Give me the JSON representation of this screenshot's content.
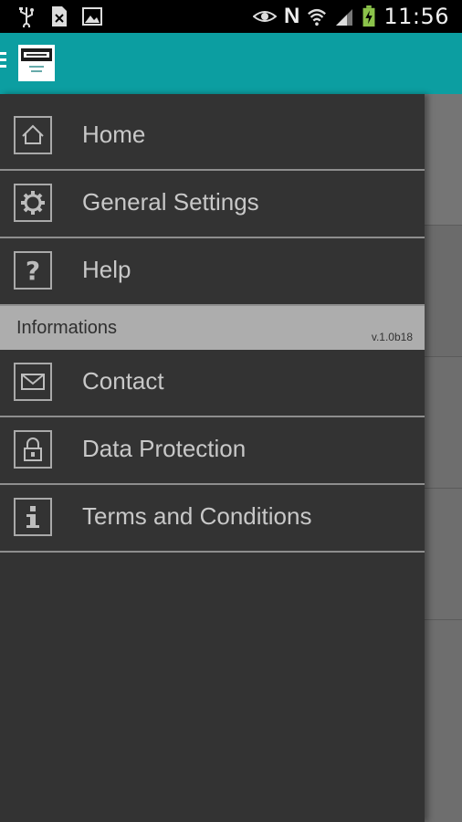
{
  "status_bar": {
    "time": "11:56",
    "network_letter": "N"
  },
  "app_bar": {
    "menu_icon": "hamburger-icon",
    "logo": "app-logo"
  },
  "drawer": {
    "items": [
      {
        "label": "Home",
        "icon": "home-icon"
      },
      {
        "label": "General Settings",
        "icon": "gear-icon"
      },
      {
        "label": "Help",
        "icon": "question-icon"
      }
    ],
    "section": {
      "title": "Informations",
      "version": "v.1.0b18"
    },
    "info_items": [
      {
        "label": "Contact",
        "icon": "mail-icon"
      },
      {
        "label": "Data Protection",
        "icon": "lock-icon"
      },
      {
        "label": "Terms and Conditions",
        "icon": "info-icon"
      }
    ]
  },
  "colors": {
    "accent": "#0c9ea1",
    "drawer_bg": "#333333",
    "section_bg": "#adadad",
    "text": "#c8c8c8"
  }
}
